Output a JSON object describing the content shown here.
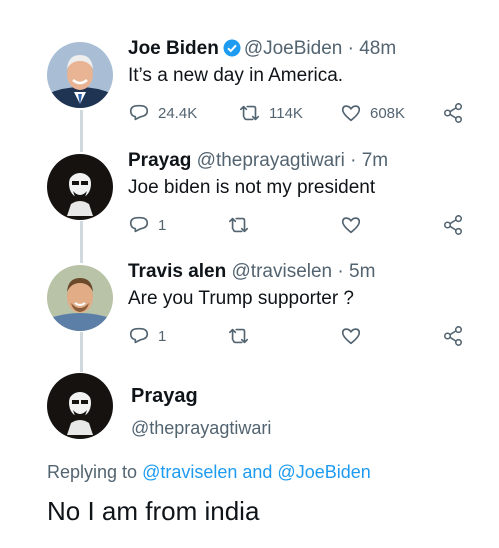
{
  "tweets": [
    {
      "name": "Joe Biden",
      "handle": "@JoeBiden",
      "dot": "·",
      "time": "48m",
      "text": "It’s a new day in America.",
      "verified": true,
      "counts": {
        "reply": "24.4K",
        "retweet": "114K",
        "like": "608K"
      }
    },
    {
      "name": "Prayag",
      "handle": "@theprayagtiwari",
      "dot": "·",
      "time": "7m",
      "text": "Joe biden is not my president",
      "counts": {
        "reply": "1",
        "retweet": "",
        "like": ""
      }
    },
    {
      "name": "Travis alen",
      "handle": "@traviselen",
      "dot": "·",
      "time": "5m",
      "text": "Are you Trump supporter ?",
      "counts": {
        "reply": "1",
        "retweet": "",
        "like": ""
      }
    }
  ],
  "focused": {
    "name": "Prayag",
    "handle": "@theprayagtiwari",
    "replying_prefix": "Replying to ",
    "replying_first": "@traviselen",
    "replying_joiner": " and ",
    "replying_second": "@JoeBiden",
    "text": "No I am from india"
  },
  "colors": {
    "accent": "#1d9bf0",
    "muted": "#536471",
    "thread_line": "#cfd9de"
  }
}
